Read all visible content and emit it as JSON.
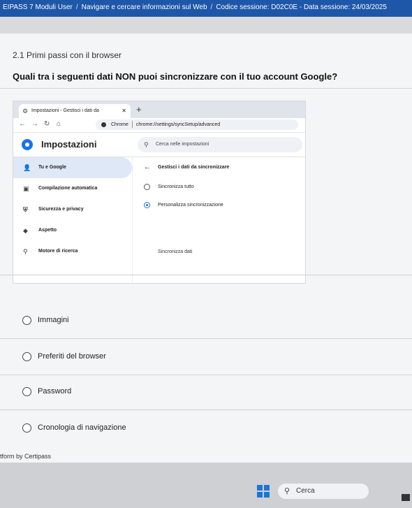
{
  "exam_bar": {
    "module": "EIPASS 7 Moduli User",
    "topic": "Navigare e cercare informazioni sul Web",
    "session": "Codice sessione: D02C0E - Data sessione: 24/03/2025",
    "separator": "/"
  },
  "section_title": "2.1 Primi passi con il browser",
  "question": "Quali tra i seguenti dati NON puoi sincronizzare con il tuo account Google?",
  "browser_screenshot": {
    "tab_title": "Impostazioni - Gestisci i dati da",
    "tab_close": "✕",
    "new_tab": "+",
    "chrome_label": "Chrome",
    "url": "chrome://settings/syncSetup/advanced",
    "app_title": "Impostazioni",
    "search_placeholder": "Cerca nelle impostazioni",
    "sidebar": [
      {
        "label": "Tu e Google",
        "icon": "person-icon",
        "glyph": "👤",
        "active": true
      },
      {
        "label": "Compilazione automatica",
        "icon": "autofill-icon",
        "glyph": "▣",
        "active": false
      },
      {
        "label": "Sicurezza e privacy",
        "icon": "shield-icon",
        "glyph": "⛨",
        "active": false
      },
      {
        "label": "Aspetto",
        "icon": "palette-icon",
        "glyph": "◆",
        "active": false
      },
      {
        "label": "Motore di ricerca",
        "icon": "search-icon",
        "glyph": "⚲",
        "active": false
      }
    ],
    "panel_title": "Gestisci i dati da sincronizzare",
    "sync_options": [
      {
        "label": "Sincronizza tutto",
        "selected": false
      },
      {
        "label": "Personalizza sincronizzazione",
        "selected": true
      }
    ],
    "sync_data_label": "Sincronizza dati"
  },
  "answers": [
    "Immagini",
    "Preferiti del browser",
    "Password",
    "Cronologia di navigazione"
  ],
  "footer": "tform by Certipass",
  "taskbar": {
    "search_label": "Cerca"
  },
  "colors": {
    "exam_bar": "#1f57a8",
    "accent": "#1a73e8"
  }
}
